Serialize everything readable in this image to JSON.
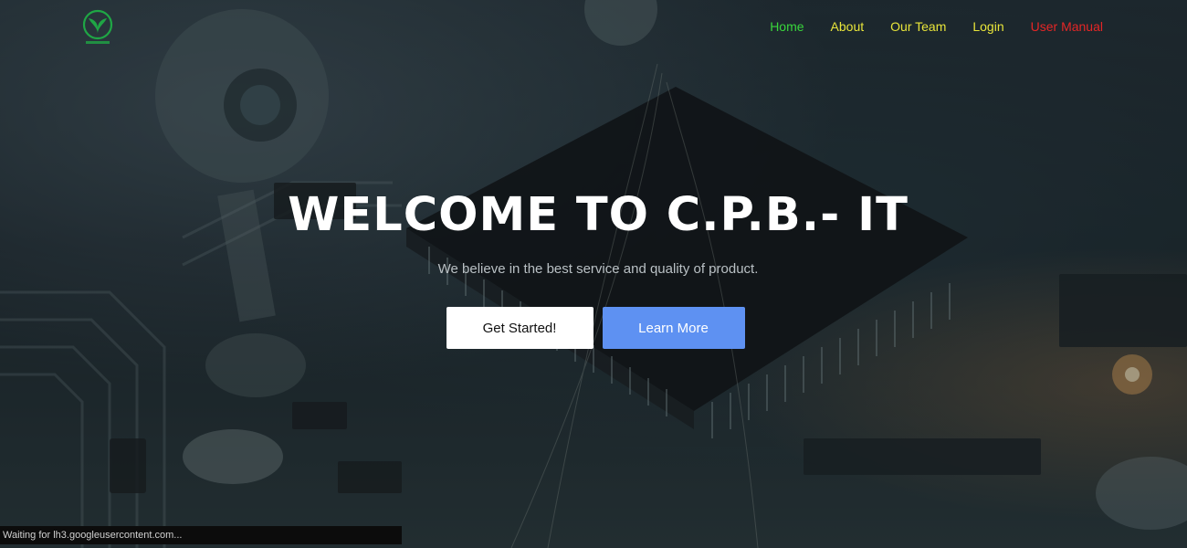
{
  "navbar": {
    "logo_icon": "cp-group-leaf-logo-icon",
    "links": [
      {
        "label": "Home",
        "color": "#39d63c"
      },
      {
        "label": "About",
        "color": "#e8e53a"
      },
      {
        "label": "Our Team",
        "color": "#e8e53a"
      },
      {
        "label": "Login",
        "color": "#e8e53a"
      },
      {
        "label": "User Manual",
        "color": "#e52626"
      }
    ]
  },
  "hero": {
    "title": "WELCOME TO C.P.B.- IT",
    "subtitle": "We believe in the best service and quality of product.",
    "primary_button": "Get Started!",
    "secondary_button": "Learn More",
    "accent_color": "#5e91f2"
  },
  "status_bar": {
    "text": "Waiting for lh3.googleusercontent.com..."
  }
}
